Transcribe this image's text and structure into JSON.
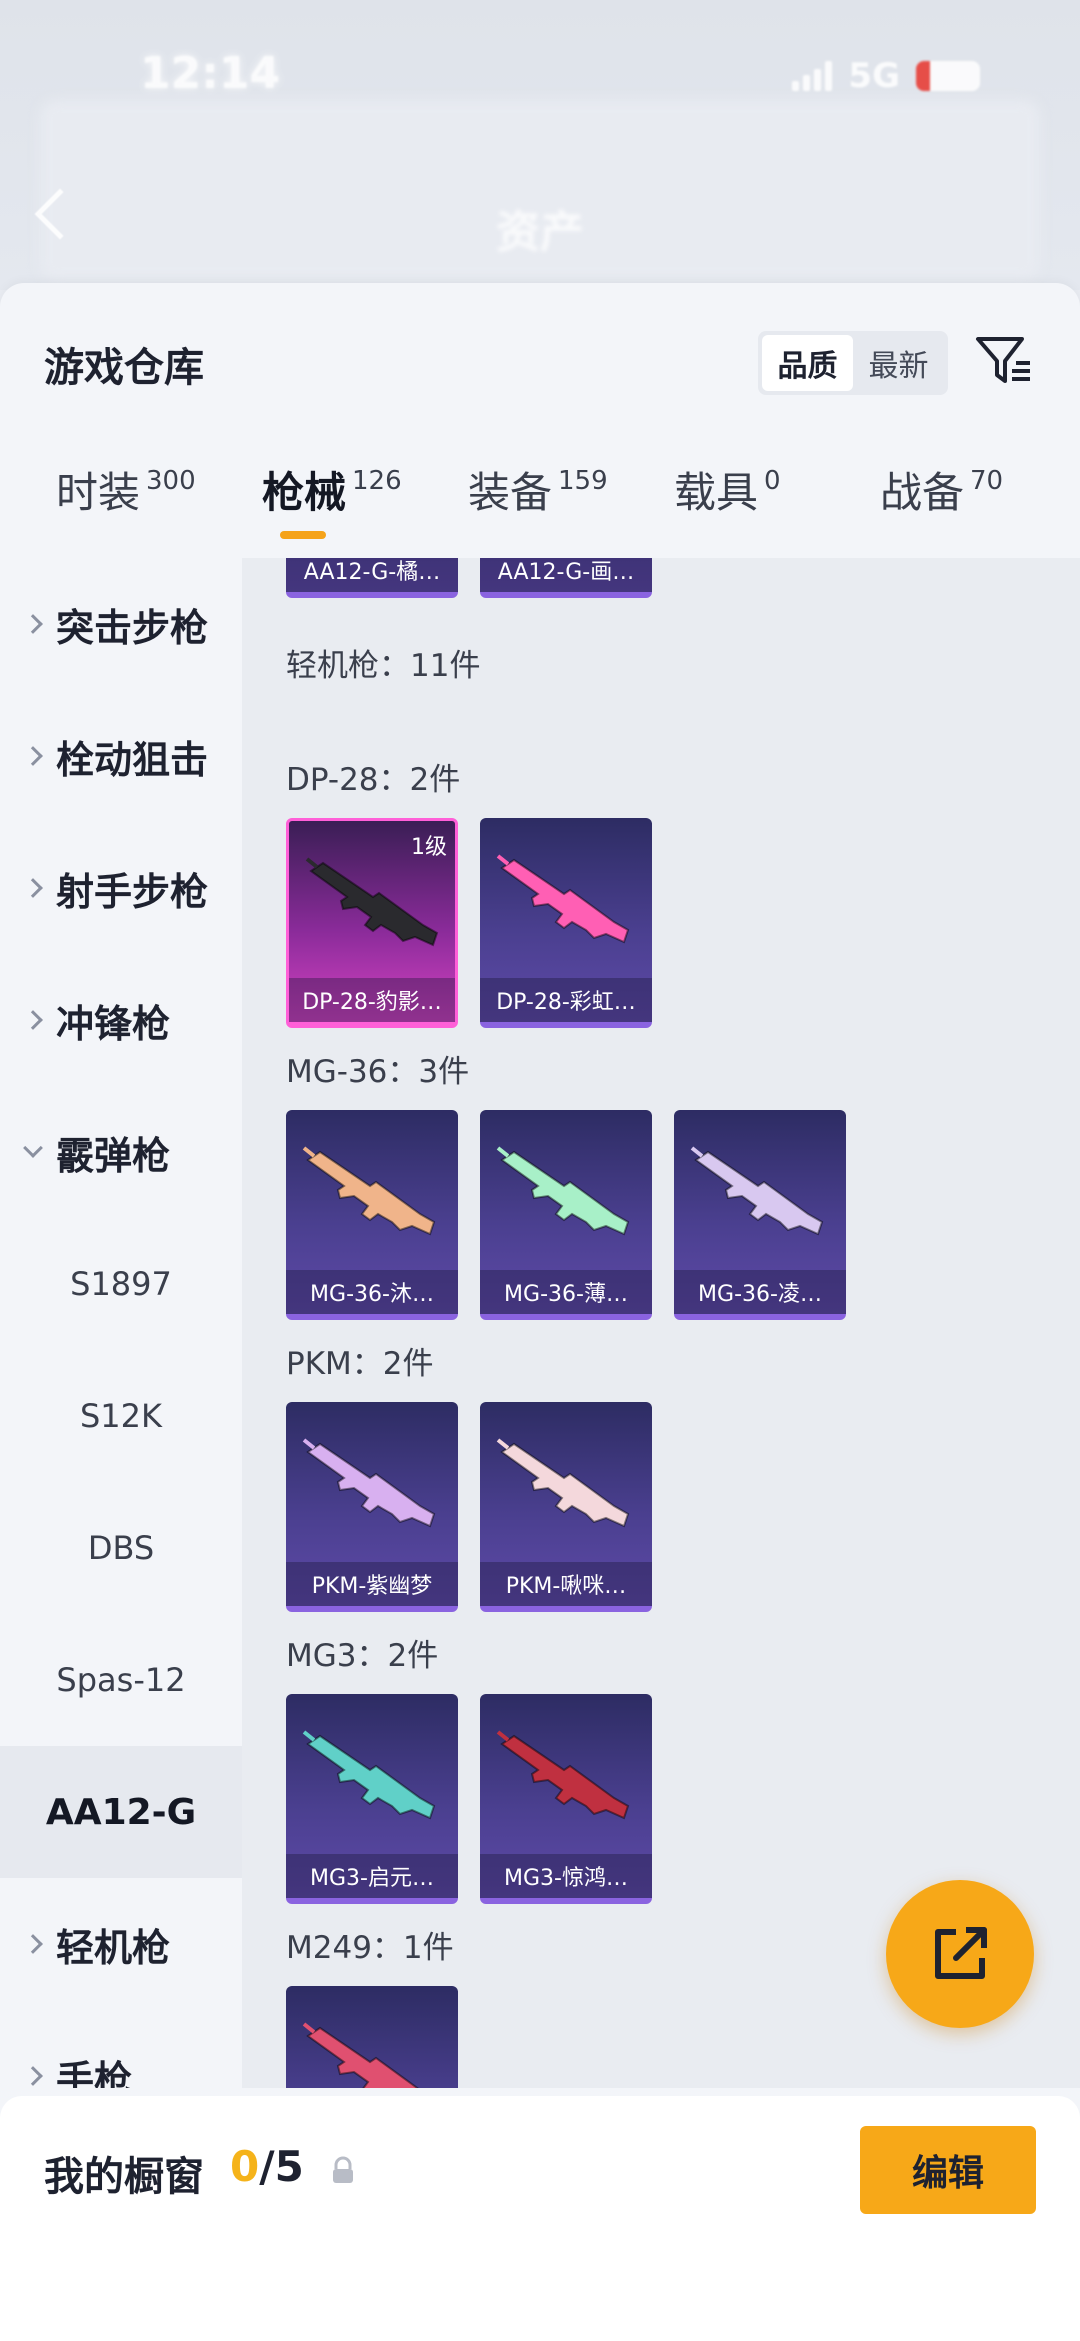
{
  "status_bar": {
    "time": "12:14",
    "network": "5G"
  },
  "header": {
    "title": "资产"
  },
  "warehouse": {
    "title": "游戏仓库",
    "sort_options": [
      "品质",
      "最新"
    ],
    "sort_active": "品质"
  },
  "tabs": [
    {
      "label": "时装",
      "count": "300"
    },
    {
      "label": "枪械",
      "count": "126",
      "active": true
    },
    {
      "label": "装备",
      "count": "159"
    },
    {
      "label": "载具",
      "count": "0"
    },
    {
      "label": "战备",
      "count": "70"
    }
  ],
  "categories": {
    "main": [
      "突击步枪",
      "栓动狙击",
      "射手步枪",
      "冲锋枪",
      "霰弹枪"
    ],
    "shotgun_sub": [
      "S1897",
      "S12K",
      "DBS",
      "Spas-12",
      "AA12-G"
    ],
    "active_sub": "AA12-G",
    "after": [
      "轻机枪",
      "手枪"
    ]
  },
  "content": {
    "top_cards": [
      "AA12-G-橘…",
      "AA12-G-画…"
    ],
    "section_title": "轻机枪：11件",
    "groups": [
      {
        "title": "DP-28：2件",
        "cards": [
          {
            "name": "DP-28-豹影…",
            "level": "1级",
            "style": "pink",
            "gun_color": "#2a2a2e"
          },
          {
            "name": "DP-28-彩虹…",
            "style": "purple",
            "gun_color": "#ff5fb4"
          }
        ]
      },
      {
        "title": "MG-36：3件",
        "cards": [
          {
            "name": "MG-36-沐…",
            "style": "purple",
            "gun_color": "#f0b48a"
          },
          {
            "name": "MG-36-薄…",
            "style": "purple",
            "gun_color": "#a8f0c8"
          },
          {
            "name": "MG-36-凌…",
            "style": "purple",
            "gun_color": "#d8c8f0"
          }
        ]
      },
      {
        "title": "PKM：2件",
        "cards": [
          {
            "name": "PKM-紫幽梦",
            "style": "purple",
            "gun_color": "#d8b0f0"
          },
          {
            "name": "PKM-啾咪…",
            "style": "purple",
            "gun_color": "#f4d8dc"
          }
        ]
      },
      {
        "title": "MG3：2件",
        "cards": [
          {
            "name": "MG3-启元…",
            "style": "purple",
            "gun_color": "#60d0c8"
          },
          {
            "name": "MG3-惊鸿…",
            "style": "purple",
            "gun_color": "#c03040"
          }
        ]
      },
      {
        "title": "M249：1件",
        "cards": [
          {
            "name": "",
            "style": "purple",
            "gun_color": "#e05070"
          }
        ]
      }
    ]
  },
  "showcase": {
    "label": "我的橱窗",
    "current": "0",
    "separator": "/",
    "max": "5",
    "edit_label": "编辑"
  },
  "colors": {
    "accent": "#f7a818",
    "tab_underline": "#f5a31a",
    "card_purple": "#4a3f8f",
    "card_pink": "#d443c2"
  }
}
